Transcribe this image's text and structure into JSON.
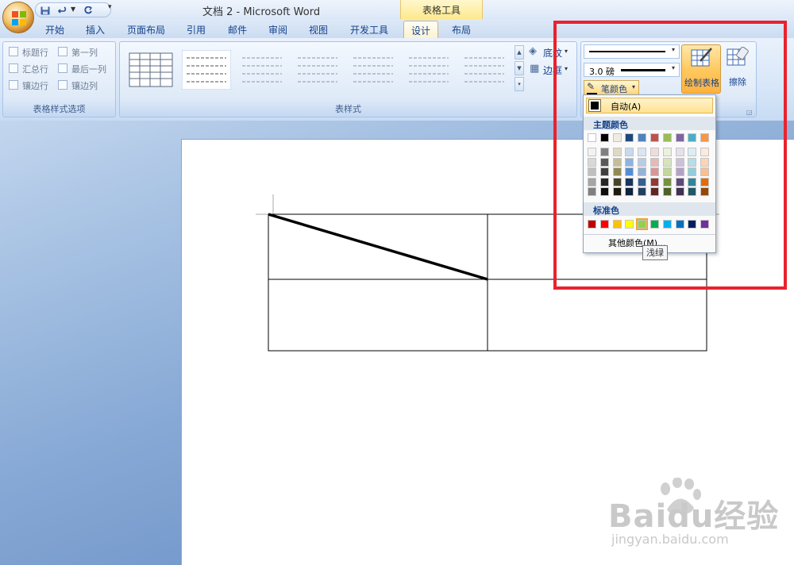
{
  "window": {
    "title": "文档 2 - Microsoft Word",
    "context_group": "表格工具"
  },
  "ribbon_tabs": [
    {
      "label": "开始"
    },
    {
      "label": "插入"
    },
    {
      "label": "页面布局"
    },
    {
      "label": "引用"
    },
    {
      "label": "邮件"
    },
    {
      "label": "审阅"
    },
    {
      "label": "视图"
    },
    {
      "label": "开发工具"
    },
    {
      "label": "设计",
      "active": true
    },
    {
      "label": "布局"
    }
  ],
  "style_options": {
    "group_label": "表格样式选项",
    "checkboxes": [
      "标题行",
      "第一列",
      "汇总行",
      "最后一列",
      "镶边行",
      "镶边列"
    ]
  },
  "table_styles": {
    "group_label": "表样式",
    "shading_label": "底纹",
    "borders_label": "边框"
  },
  "draw_borders": {
    "line_weight": "3.0 磅",
    "pen_color_label": "笔颜色",
    "draw_table_label": "绘制表格",
    "eraser_label": "擦除"
  },
  "color_menu": {
    "auto_label": "自动(A)",
    "theme_title": "主题颜色",
    "theme_top": [
      "#ffffff",
      "#000000",
      "#eeece1",
      "#1f497d",
      "#4f81bd",
      "#c0504d",
      "#9bbb59",
      "#8064a2",
      "#4bacc6",
      "#f79646"
    ],
    "theme_shades": [
      [
        "#f2f2f2",
        "#808080",
        "#ddd9c3",
        "#c6d9f0",
        "#dbe5f1",
        "#f2dcdb",
        "#ebf1dd",
        "#e5e0ec",
        "#dbeef3",
        "#fdeada"
      ],
      [
        "#d8d8d8",
        "#595959",
        "#c4bd97",
        "#8db3e2",
        "#b8cce4",
        "#e5b9b7",
        "#d7e3bc",
        "#ccc1d9",
        "#b7dde8",
        "#fbd5b5"
      ],
      [
        "#bfbfbf",
        "#3f3f3f",
        "#938953",
        "#548dd4",
        "#95b3d7",
        "#d99694",
        "#c3d69b",
        "#b2a2c7",
        "#92cddc",
        "#fac08f"
      ],
      [
        "#a5a5a5",
        "#262626",
        "#494429",
        "#17365d",
        "#366092",
        "#953734",
        "#76923c",
        "#5f497a",
        "#31859b",
        "#e36c09"
      ],
      [
        "#7f7f7f",
        "#0c0c0c",
        "#1d1b10",
        "#0f243e",
        "#244061",
        "#632423",
        "#4f6128",
        "#3f3151",
        "#205867",
        "#974806"
      ]
    ],
    "standard_title": "标准色",
    "standard": [
      "#c00000",
      "#ff0000",
      "#ffc000",
      "#ffff00",
      "#92d050",
      "#00b050",
      "#00b0f0",
      "#0070c0",
      "#002060",
      "#7030a0"
    ],
    "more_label": "其他颜色(M)...",
    "tooltip": "浅绿"
  },
  "watermark": {
    "text": "Baidu经验",
    "url": "jingyan.baidu.com"
  },
  "colors": {
    "highlight_box": "#e8232e",
    "accent": "#15428b"
  }
}
